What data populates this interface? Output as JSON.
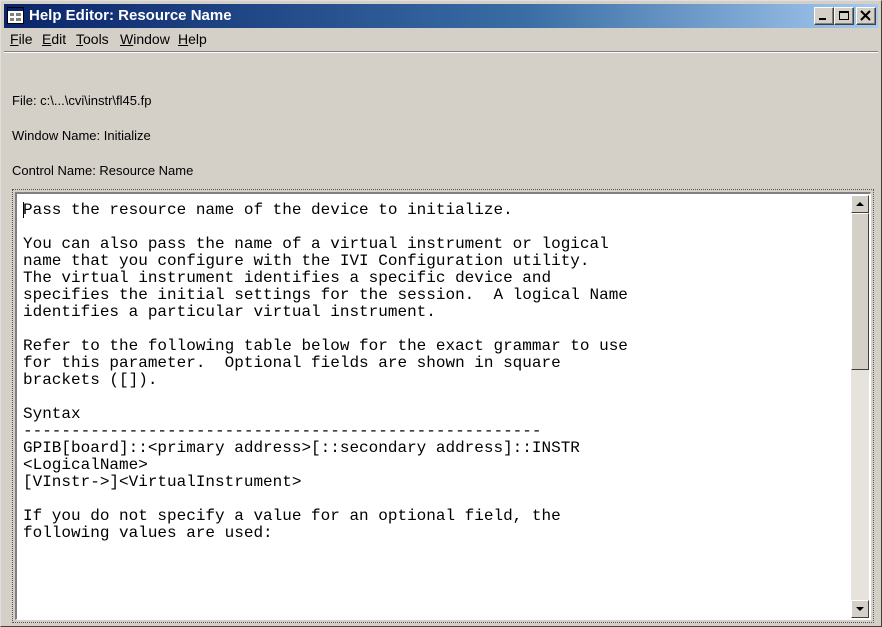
{
  "window": {
    "title": "Help Editor:  Resource Name",
    "icon": "help-editor-app-icon",
    "controls": [
      "minimize-icon",
      "maximize-icon",
      "close-icon"
    ]
  },
  "menu": [
    {
      "label": "File",
      "underline": "F",
      "rest": "ile"
    },
    {
      "label": "Edit",
      "underline": "E",
      "rest": "dit"
    },
    {
      "label": "Tools",
      "underline": "T",
      "rest": "ools"
    },
    {
      "label": "Window",
      "underline": "W",
      "rest": "indow"
    },
    {
      "label": "Help",
      "underline": "H",
      "rest": "elp"
    }
  ],
  "info": {
    "file": "File:  c:\\...\\cvi\\instr\\fl45.fp",
    "window_name": "Window Name:  Initialize",
    "control_name": "Control Name:  Resource Name"
  },
  "help_text": {
    "lines": [
      "Pass the resource name of the device to initialize.",
      "",
      "You can also pass the name of a virtual instrument or logical",
      "name that you configure with the IVI Configuration utility.",
      "The virtual instrument identifies a specific device and",
      "specifies the initial settings for the session.  A logical Name",
      "identifies a particular virtual instrument.",
      "",
      "Refer to the following table below for the exact grammar to use",
      "for this parameter.  Optional fields are shown in square",
      "brackets ([]).",
      "",
      "Syntax",
      "------------------------------------------------------",
      "GPIB[board]::<primary address>[::secondary address]::INSTR",
      "<LogicalName>",
      "[VInstr->]<VirtualInstrument>",
      "",
      "If you do not specify a value for an optional field, the",
      "following values are used:"
    ]
  },
  "colors": {
    "titlebar_start": "#0a246a",
    "titlebar_end": "#a6caf0",
    "face": "#d4d0c8"
  }
}
